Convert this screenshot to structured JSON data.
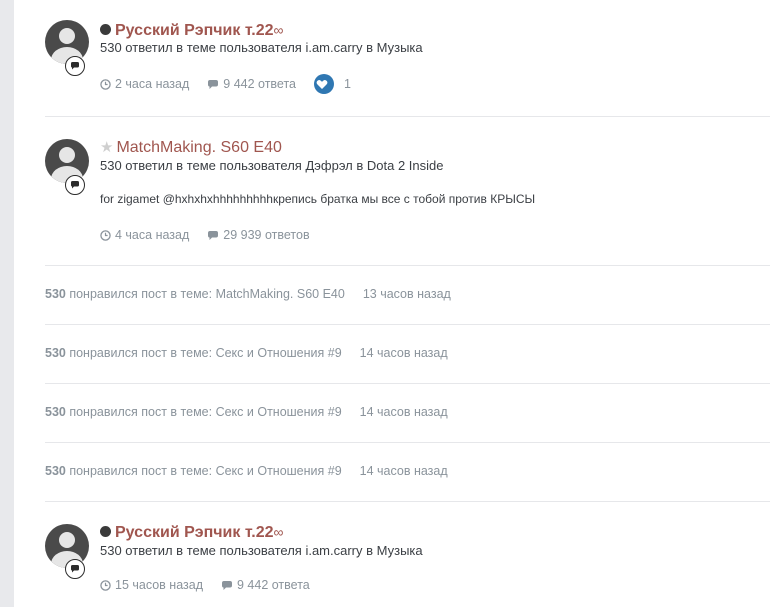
{
  "entries": [
    {
      "status_dot": true,
      "title": "Русский Рэпчик т.22",
      "title_suffix": "∞",
      "subline_pre": "530 ответил в теме пользователя ",
      "author": "i.am.carry",
      "subline_mid": " в ",
      "forum": "Музыка",
      "time": "2 часа назад",
      "replies": "9 442 ответа",
      "likes": "1"
    },
    {
      "star": "★",
      "title": "MatchMaking. S60 E40",
      "subline_pre": "530 ответил в теме пользователя ",
      "author": "Дэфрэл",
      "subline_mid": " в ",
      "forum": "Dota 2 Inside",
      "snippet": "for zigamet @hxhxhxhhhhhhhhhкрепись братка мы все с тобой против КРЫСЫ",
      "time": "4 часа назад",
      "replies": "29 939 ответов"
    },
    {
      "status_dot": true,
      "title": "Русский Рэпчик т.22",
      "title_suffix": "∞",
      "subline_pre": "530 ответил в теме пользователя ",
      "author": "i.am.carry",
      "subline_mid": " в ",
      "forum": "Музыка",
      "time": "15 часов назад",
      "replies": "9 442 ответа"
    }
  ],
  "likes": [
    {
      "user": "530",
      "text": " понравился пост в теме: MatchMaking. S60 E40",
      "time": "13 часов назад"
    },
    {
      "user": "530",
      "text": " понравился пост в теме: Секс и Отношения #9",
      "time": "14 часов назад"
    },
    {
      "user": "530",
      "text": " понравился пост в теме: Секс и Отношения #9",
      "time": "14 часов назад"
    },
    {
      "user": "530",
      "text": " понравился пост в теме: Секс и Отношения #9",
      "time": "14 часов назад"
    }
  ],
  "colors": {
    "title": "#a0564f",
    "meta": "#8a939b",
    "like_button": "#2f77b2",
    "divider": "#e6e7ea"
  }
}
